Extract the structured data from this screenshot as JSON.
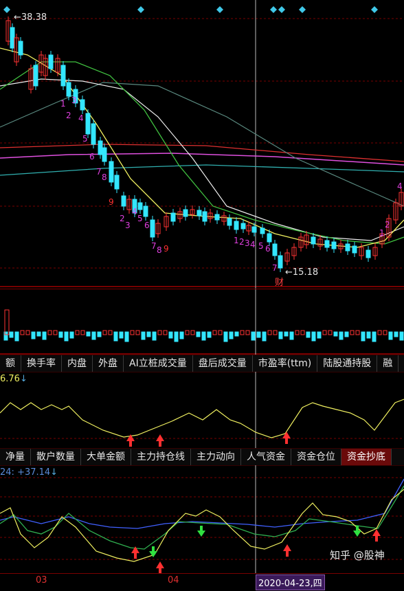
{
  "main_chart": {
    "high_label": "38.38",
    "low_label": "15.18",
    "event_marker": "财",
    "seq_numbers": [
      "1",
      "2",
      "3",
      "4",
      "5",
      "6",
      "7",
      "8",
      "9",
      "2",
      "3",
      "4",
      "5",
      "6",
      "7",
      "8",
      "9",
      "1",
      "2",
      "3",
      "4",
      "5",
      "6",
      "7",
      "1",
      "2",
      "4"
    ]
  },
  "tabs_top": {
    "items": [
      {
        "label": "额"
      },
      {
        "label": "换手率"
      },
      {
        "label": "内盘"
      },
      {
        "label": "外盘"
      },
      {
        "label": "AI立桩成交量"
      },
      {
        "label": "盘后成交量"
      },
      {
        "label": "市盈率(ttm)"
      },
      {
        "label": "陆股通持股"
      },
      {
        "label": "融"
      }
    ]
  },
  "indicator1": {
    "readout": "6.76"
  },
  "tabs_bottom": {
    "items": [
      {
        "label": "净量",
        "active": false
      },
      {
        "label": "散户数量",
        "active": false
      },
      {
        "label": "大单金额",
        "active": false
      },
      {
        "label": "主力持仓线",
        "active": false
      },
      {
        "label": "主力动向",
        "active": false
      },
      {
        "label": "人气资金",
        "active": false
      },
      {
        "label": "资金仓位",
        "active": false
      },
      {
        "label": "资金抄底",
        "active": true
      }
    ]
  },
  "indicator2": {
    "readout_a": "24:",
    "readout_b": "+37.14"
  },
  "date_axis": {
    "labels": [
      "03",
      "04"
    ],
    "cursor_date": "2020-04-23,四"
  },
  "watermark": {
    "text": "知乎 @股神"
  },
  "colors": {
    "up": "#ff3333",
    "down": "#33e6ff",
    "ma_white": "#f0f0f0",
    "ma_yellow": "#f0f060",
    "ma_green": "#40c040",
    "ma_red": "#e03030",
    "ma_magenta": "#e050e0",
    "ma_cyan": "#30b0b0"
  }
}
